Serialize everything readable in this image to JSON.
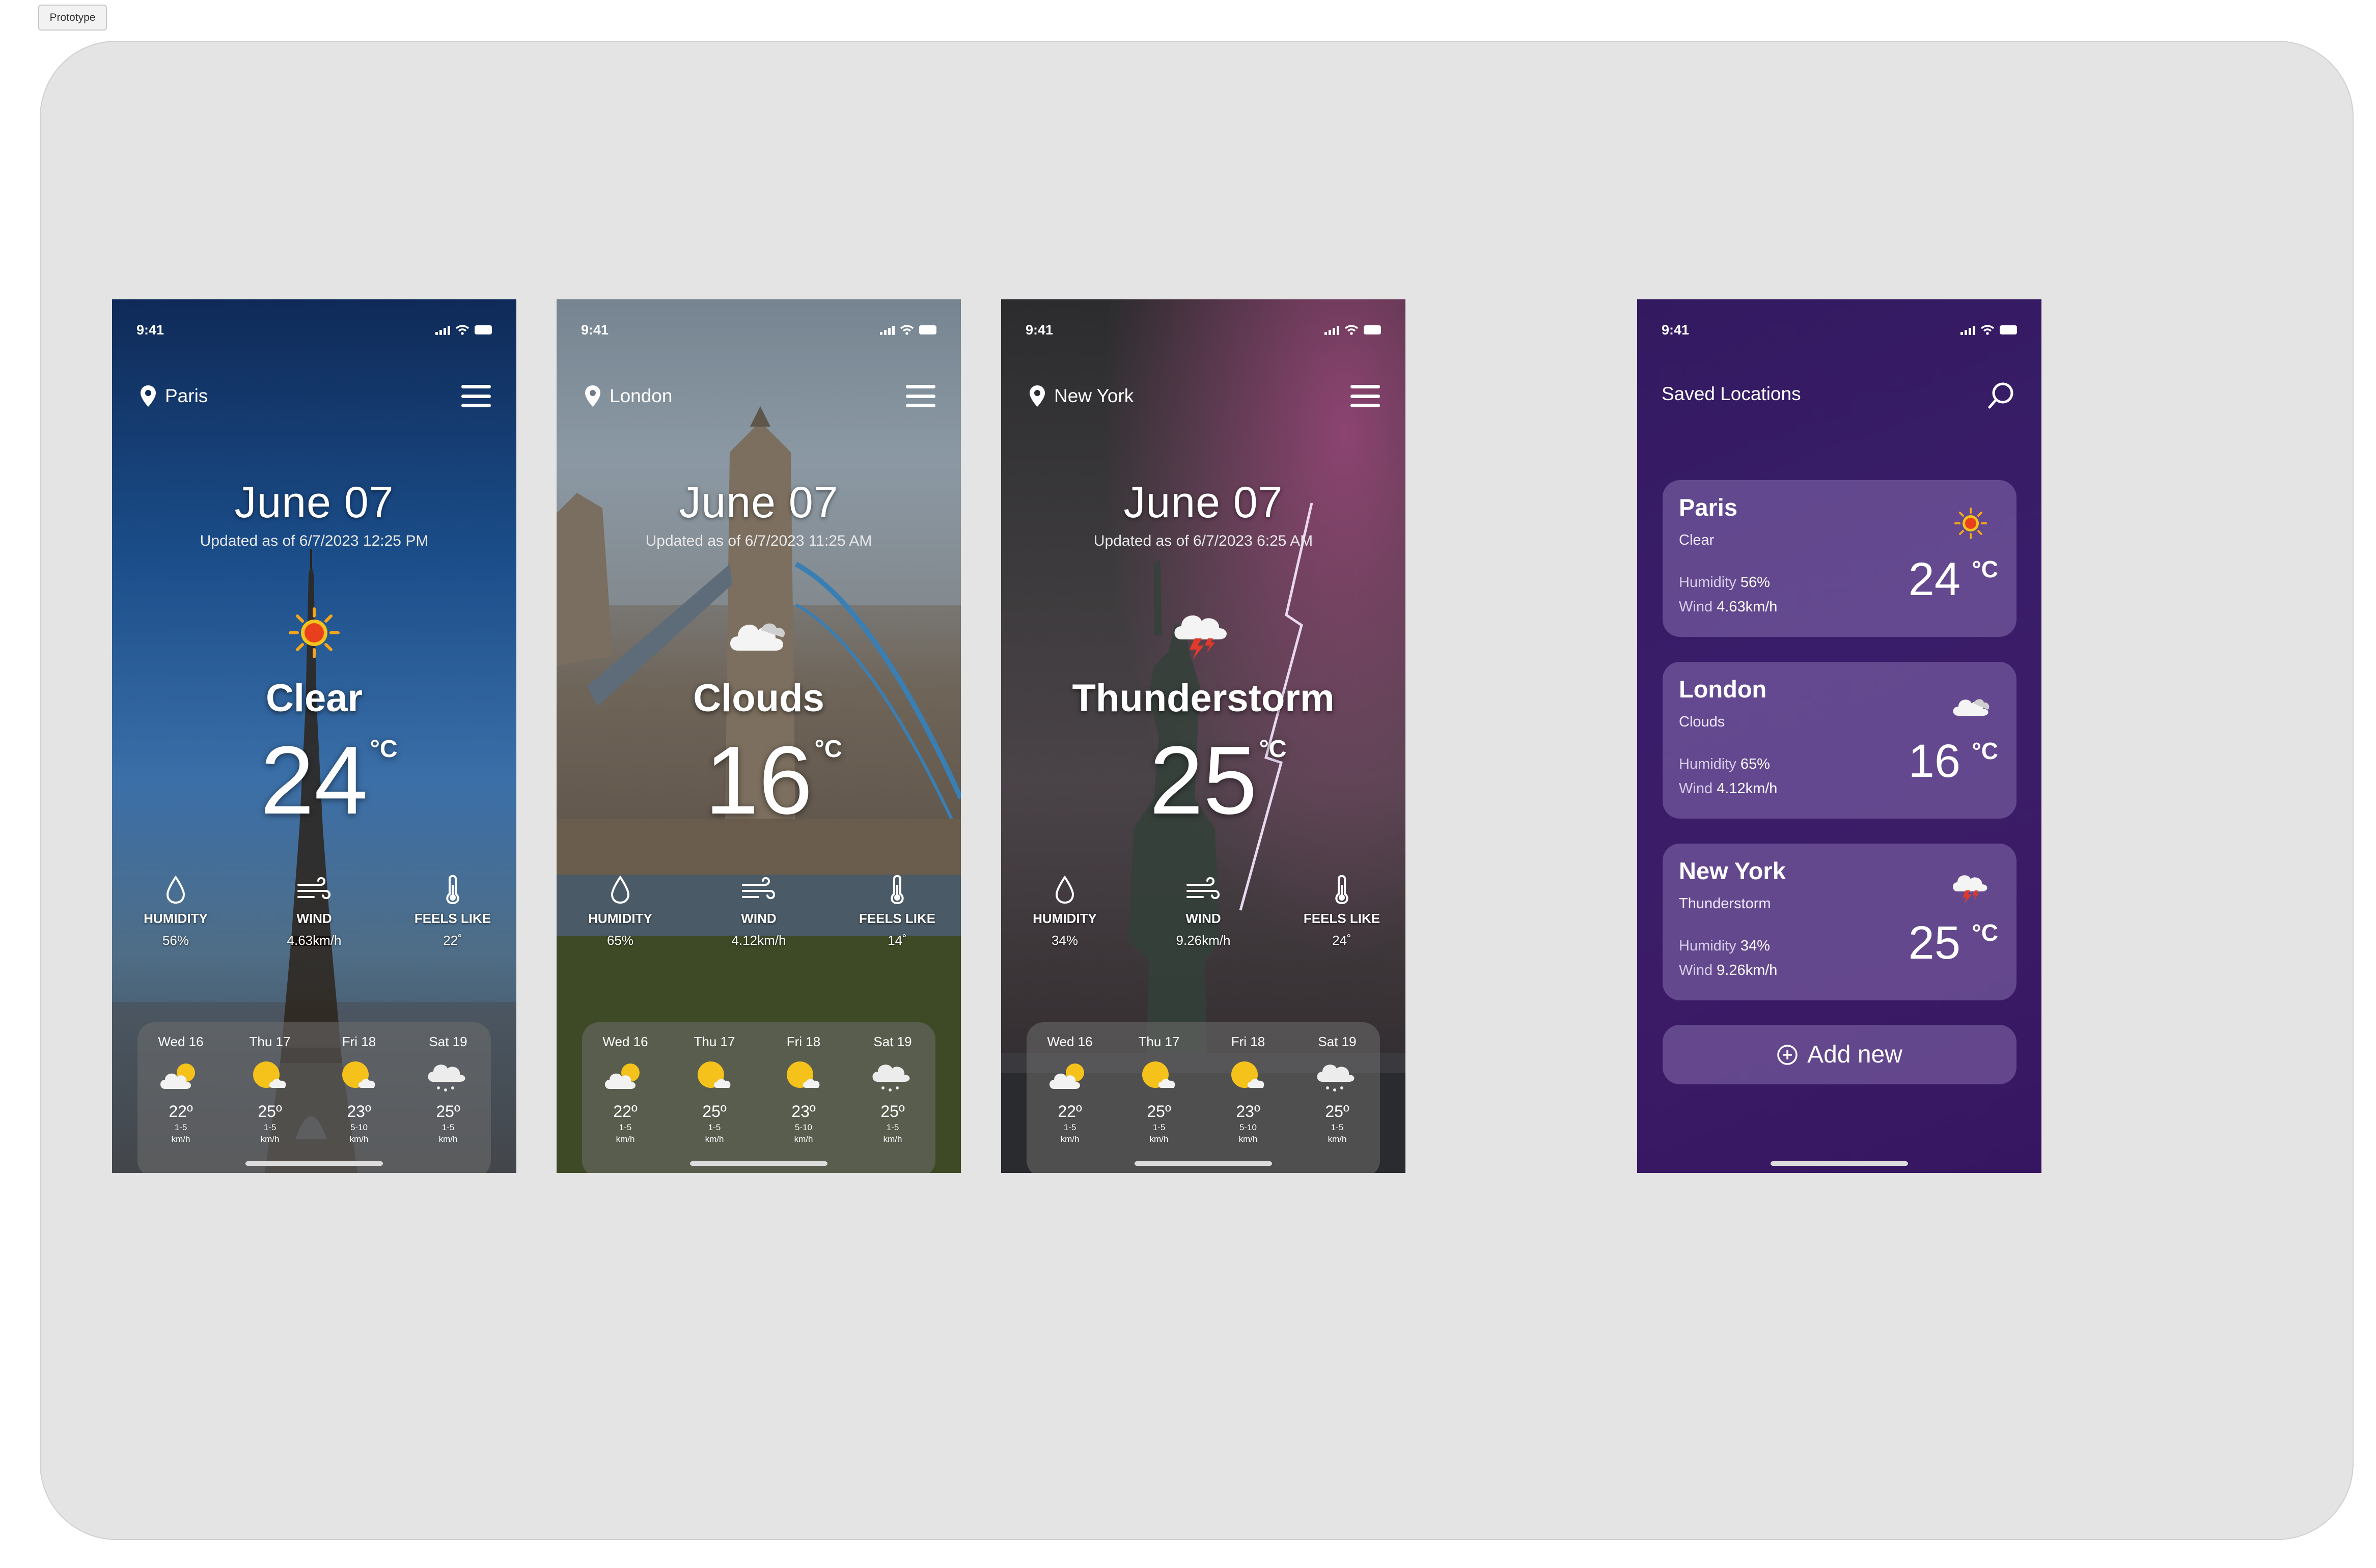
{
  "frame_label": "Prototype",
  "status_time": "9:41",
  "screens": [
    {
      "location": "Paris",
      "date": "June 07",
      "updated": "Updated as of 6/7/2023 12:25 PM",
      "condition": "Clear",
      "condition_icon": "sun-icon",
      "temp": "24",
      "unit": "°C",
      "humidity_label": "HUMIDITY",
      "humidity": "56%",
      "wind_label": "WIND",
      "wind": "4.63km/h",
      "feels_label": "FEELS LIKE",
      "feels": "22˚",
      "forecast": [
        {
          "day": "Wed 16",
          "icon": "partly-cloudy-icon",
          "temp": "22º",
          "wind": "1-5",
          "unit": "km/h"
        },
        {
          "day": "Thu 17",
          "icon": "sunny-cloud-icon",
          "temp": "25º",
          "wind": "1-5",
          "unit": "km/h"
        },
        {
          "day": "Fri 18",
          "icon": "sunny-cloud-icon",
          "temp": "23º",
          "wind": "5-10",
          "unit": "km/h"
        },
        {
          "day": "Sat 19",
          "icon": "rain-cloud-icon",
          "temp": "25º",
          "wind": "1-5",
          "unit": "km/h"
        }
      ]
    },
    {
      "location": "London",
      "date": "June 07",
      "updated": "Updated as of 6/7/2023 11:25 AM",
      "condition": "Clouds",
      "condition_icon": "cloud-icon",
      "temp": "16",
      "unit": "°C",
      "humidity_label": "HUMIDITY",
      "humidity": "65%",
      "wind_label": "WIND",
      "wind": "4.12km/h",
      "feels_label": "FEELS LIKE",
      "feels": "14˚",
      "forecast": [
        {
          "day": "Wed 16",
          "icon": "partly-cloudy-icon",
          "temp": "22º",
          "wind": "1-5",
          "unit": "km/h"
        },
        {
          "day": "Thu 17",
          "icon": "sunny-cloud-icon",
          "temp": "25º",
          "wind": "1-5",
          "unit": "km/h"
        },
        {
          "day": "Fri 18",
          "icon": "sunny-cloud-icon",
          "temp": "23º",
          "wind": "5-10",
          "unit": "km/h"
        },
        {
          "day": "Sat 19",
          "icon": "rain-cloud-icon",
          "temp": "25º",
          "wind": "1-5",
          "unit": "km/h"
        }
      ]
    },
    {
      "location": "New York",
      "date": "June 07",
      "updated": "Updated as of 6/7/2023 6:25 AM",
      "condition": "Thunderstorm",
      "condition_icon": "thunderstorm-icon",
      "temp": "25",
      "unit": "°C",
      "humidity_label": "HUMIDITY",
      "humidity": "34%",
      "wind_label": "WIND",
      "wind": "9.26km/h",
      "feels_label": "FEELS LIKE",
      "feels": "24˚",
      "forecast": [
        {
          "day": "Wed 16",
          "icon": "partly-cloudy-icon",
          "temp": "22º",
          "wind": "1-5",
          "unit": "km/h"
        },
        {
          "day": "Thu 17",
          "icon": "sunny-cloud-icon",
          "temp": "25º",
          "wind": "1-5",
          "unit": "km/h"
        },
        {
          "day": "Fri 18",
          "icon": "sunny-cloud-icon",
          "temp": "23º",
          "wind": "5-10",
          "unit": "km/h"
        },
        {
          "day": "Sat 19",
          "icon": "rain-cloud-icon",
          "temp": "25º",
          "wind": "1-5",
          "unit": "km/h"
        }
      ]
    }
  ],
  "saved": {
    "title": "Saved Locations",
    "humidity_label": "Humidity",
    "wind_label": "Wind",
    "cards": [
      {
        "name": "Paris",
        "condition": "Clear",
        "icon": "sun-icon",
        "humidity": "56%",
        "wind": "4.63km/h",
        "temp": "24",
        "unit": "°C"
      },
      {
        "name": "London",
        "condition": "Clouds",
        "icon": "cloud-icon",
        "humidity": "65%",
        "wind": "4.12km/h",
        "temp": "16",
        "unit": "°C"
      },
      {
        "name": "New York",
        "condition": "Thunderstorm",
        "icon": "thunderstorm-icon",
        "humidity": "34%",
        "wind": "9.26km/h",
        "temp": "25",
        "unit": "°C"
      }
    ],
    "add_label": "Add new"
  },
  "colors": {
    "canvas": "#e4e4e4",
    "paris_sky": "#1b4e8a",
    "saved_bg": "#3a1d6a",
    "card": "#8d6fb5",
    "sun": "#f5c21b",
    "sun_core": "#e8401c"
  }
}
